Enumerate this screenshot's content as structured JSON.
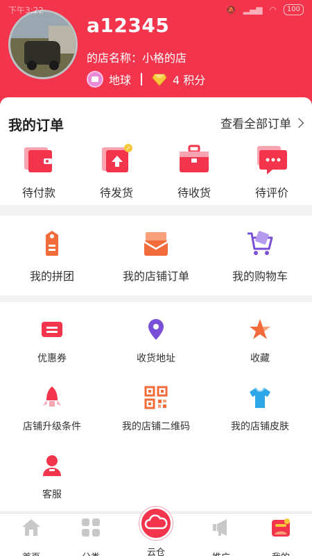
{
  "status_bar": {
    "time": "下午3:22",
    "battery": "100"
  },
  "profile": {
    "username": "a12345",
    "shop_name": "的店名称：小格的店",
    "level": "地球",
    "points": "4 积分"
  },
  "orders": {
    "title": "我的订单",
    "view_all": "查看全部订单",
    "items": [
      {
        "label": "待付款",
        "icon": "wallet-icon"
      },
      {
        "label": "待发货",
        "icon": "ship-package-icon"
      },
      {
        "label": "待收货",
        "icon": "briefcase-icon"
      },
      {
        "label": "待评价",
        "icon": "comment-icon"
      }
    ]
  },
  "section2": {
    "items": [
      {
        "label": "我的拼团",
        "icon": "group-tag-icon"
      },
      {
        "label": "我的店铺订单",
        "icon": "mail-icon"
      },
      {
        "label": "我的购物车",
        "icon": "cart-icon"
      }
    ]
  },
  "section3": {
    "items": [
      {
        "label": "优惠券",
        "icon": "coupon-icon"
      },
      {
        "label": "收货地址",
        "icon": "location-icon"
      },
      {
        "label": "收藏",
        "icon": "star-icon"
      },
      {
        "label": "店铺升级条件",
        "icon": "rocket-icon"
      },
      {
        "label": "我的店铺二维码",
        "icon": "qr-code-icon"
      },
      {
        "label": "我的店铺皮肤",
        "icon": "shirt-icon"
      },
      {
        "label": "客服",
        "icon": "customer-service-icon"
      }
    ]
  },
  "bottom_nav": {
    "items": [
      {
        "label": "首页",
        "icon": "home-icon"
      },
      {
        "label": "分类",
        "icon": "grid-icon"
      },
      {
        "label": "云仓",
        "icon": "cloud-icon"
      },
      {
        "label": "推广",
        "icon": "megaphone-icon"
      },
      {
        "label": "我的",
        "icon": "user-icon"
      }
    ],
    "active": "我的"
  },
  "colors": {
    "accent": "#f2344c",
    "orange": "#f26b3a",
    "purple": "#7a4fd8",
    "blue": "#2ea7e8"
  }
}
